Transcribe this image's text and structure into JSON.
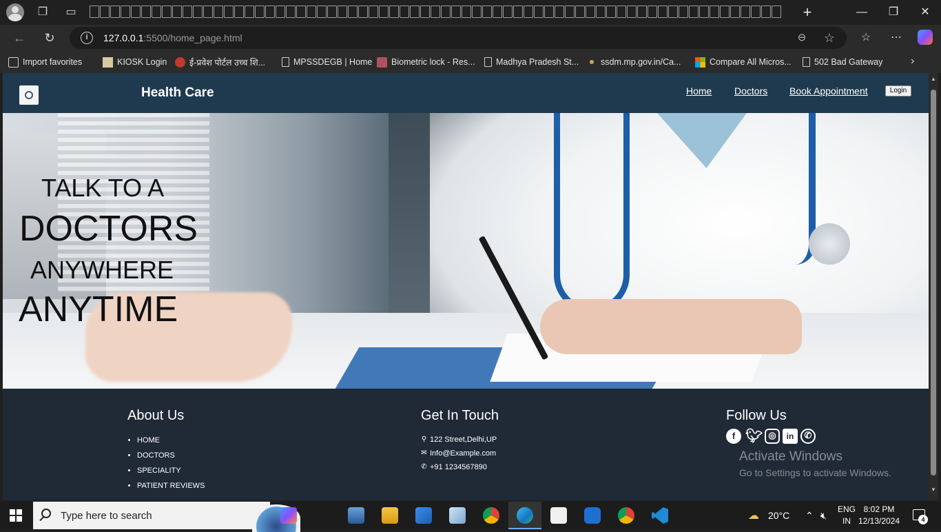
{
  "browser": {
    "url_host": "127.0.0.1",
    "url_path": ":5500/home_page.html",
    "bookmarks": [
      "Import favorites",
      "KIOSK Login",
      "ई-प्रवेश पोर्टल उच्च शि...",
      "MPSSDEGB | Home",
      "Biometric lock - Res...",
      "Madhya Pradesh St...",
      "ssdm.mp.gov.in/Ca...",
      "Compare All Micros...",
      "502 Bad Gateway"
    ]
  },
  "navbar": {
    "brand": "Health Care",
    "links": [
      "Home",
      "Doctors",
      "Book Appointment"
    ],
    "login_label": "Login"
  },
  "hero": {
    "line1": "TALK TO A",
    "line2": "DOCTORS",
    "line3": "ANYWHERE",
    "line4": "ANYTIME"
  },
  "footer": {
    "about": {
      "heading": "About Us",
      "items": [
        "HOME",
        "DOCTORS",
        "SPECIALITY",
        "PATIENT REVIEWS"
      ]
    },
    "contact": {
      "heading": "Get In Touch",
      "address": "122 Street,Delhi,UP",
      "email": "Info@Example.com",
      "phone": "+91 1234567890"
    },
    "follow": {
      "heading": "Follow Us",
      "icons": [
        "facebook-icon",
        "twitter-icon",
        "instagram-icon",
        "linkedin-icon",
        "whatsapp-icon"
      ]
    }
  },
  "watermark": {
    "title": "Activate Windows",
    "subtitle": "Go to Settings to activate Windows."
  },
  "taskbar": {
    "search_placeholder": "Type here to search",
    "weather": "20°C",
    "lang_line1": "ENG",
    "lang_line2": "IN",
    "time": "8:02 PM",
    "date": "12/13/2024",
    "notification_count": "4"
  },
  "colors": {
    "navbar_bg": "#1f3a4e",
    "footer_bg": "#1f2a36",
    "taskbar_bg": "#1c1c1c"
  }
}
